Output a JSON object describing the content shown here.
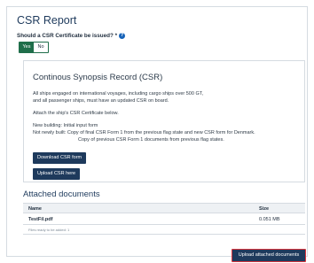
{
  "page": {
    "title": "CSR Report",
    "question_label": "Should a CSR Certificate be issued? *",
    "help_icon": "question-circle-icon",
    "toggle": {
      "options": [
        "Yes",
        "No"
      ],
      "selected": "Yes"
    }
  },
  "panel": {
    "title": "Continous Synopsis Record (CSR)",
    "line1": "All ships engaged on international voyages, including cargo ships over 500 GT,",
    "line2": "and all passenger ships, must have an updated CSR on board.",
    "attach_text": "Attach the ship's CSR Certificate below.",
    "new_building": "New building:  Initial input form",
    "not_newly_1": "Not newly built:  Copy of final CSR Form 1 from the previous flag state and new CSR form for Denmark.",
    "not_newly_2": "Copy of previous CSR Form 1 documents from previous flag states.",
    "download_button": "Download CSR form",
    "upload_button": "Upload CSR here"
  },
  "attached": {
    "title": "Attached documents",
    "columns": [
      "Name",
      "Size"
    ],
    "rows": [
      {
        "name": "TestFil.pdf",
        "size": "0.051 MB"
      }
    ],
    "footer": "Files ready to be added: 1",
    "upload_button": "Upload attached documents"
  },
  "colors": {
    "primary": "#1e3a5c",
    "toggle_selected": "#1f6e4a",
    "help_icon": "#1763b8",
    "highlight_border": "#d9363e"
  }
}
